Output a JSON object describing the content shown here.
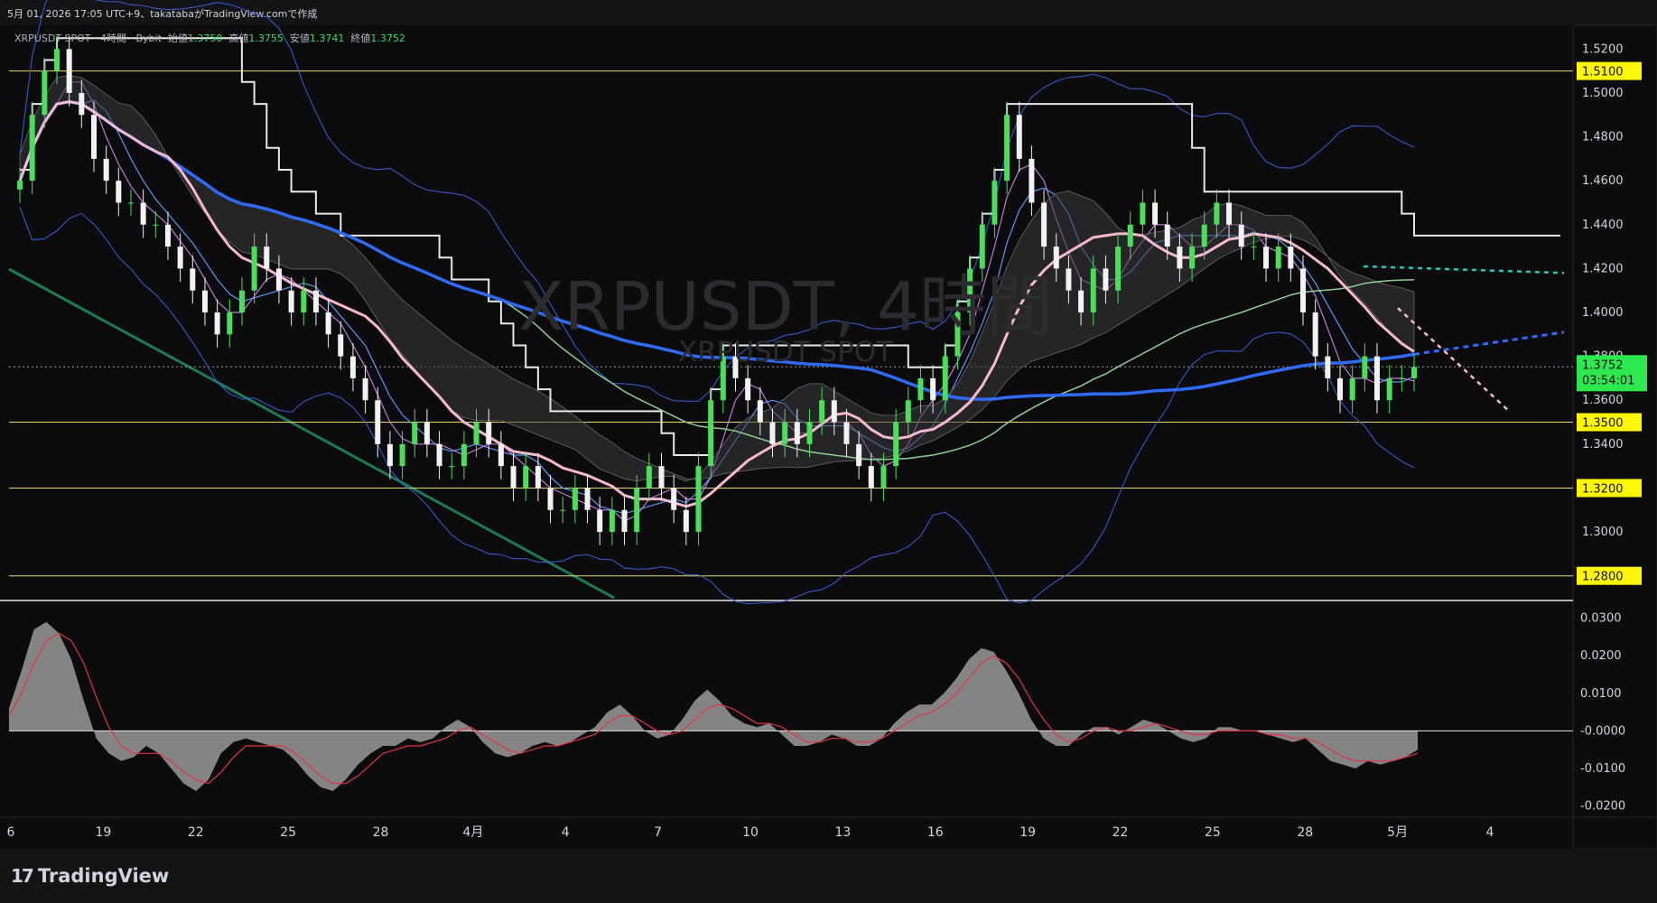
{
  "header": {
    "caption": "5月 01, 2026 17:05 UTC+9、takatabaがTradingView.comで作成"
  },
  "legend": {
    "symbol": "XRPUSDT SPOT · 4時間 · Bybit",
    "open_label": "始値",
    "open": "1.3750",
    "high_label": "高値",
    "high": "1.3755",
    "low_label": "安値",
    "low": "1.3741",
    "close_label": "終値",
    "close": "1.3752"
  },
  "watermark": {
    "title": "XRPUSDT, 4時間",
    "subtitle": "XRPUSDT SPOT"
  },
  "price_tags": {
    "current_price": "1.3752",
    "countdown": "03:54:01"
  },
  "branding": {
    "name": "TradingView",
    "mark": "17"
  },
  "colors": {
    "bg": "#0c0c0e",
    "up": "#4ade5a",
    "down": "#f2f2f2",
    "ma_pink": "#f5b8cc",
    "ma_blue": "#2f6bf5",
    "ma_green": "#8fd08f",
    "bollinger": "#3760d8",
    "trend_green": "#1f7a52",
    "level_yellow": "#e6d96a",
    "white_line": "#e9e9e9",
    "cyan_dash": "#33c4b8",
    "osc_fill": "#9a9a9a",
    "osc_signal": "#e0373f"
  },
  "chart_data": [
    {
      "type": "candlestick",
      "title": "XRPUSDT, 4時間",
      "x_ticks": [
        "6",
        "19",
        "22",
        "25",
        "28",
        "4月",
        "4",
        "7",
        "10",
        "13",
        "16",
        "19",
        "22",
        "25",
        "28",
        "5月",
        "4"
      ],
      "y_ticks": [
        "1.5200",
        "1.5000",
        "1.4800",
        "1.4600",
        "1.4400",
        "1.4200",
        "1.4000",
        "1.3800",
        "1.3600",
        "1.3400",
        "1.3000"
      ],
      "ylim": [
        1.27,
        1.53
      ],
      "horizontal_levels": [
        "1.5100",
        "1.3500",
        "1.3200",
        "1.2800"
      ],
      "last_price": 1.3752,
      "closes": [
        1.46,
        1.49,
        1.51,
        1.52,
        1.5,
        1.49,
        1.47,
        1.46,
        1.45,
        1.45,
        1.44,
        1.44,
        1.43,
        1.42,
        1.41,
        1.4,
        1.39,
        1.4,
        1.41,
        1.43,
        1.42,
        1.41,
        1.4,
        1.41,
        1.4,
        1.39,
        1.38,
        1.37,
        1.36,
        1.34,
        1.33,
        1.34,
        1.35,
        1.34,
        1.33,
        1.33,
        1.34,
        1.35,
        1.34,
        1.33,
        1.32,
        1.33,
        1.32,
        1.31,
        1.31,
        1.32,
        1.31,
        1.3,
        1.31,
        1.3,
        1.32,
        1.33,
        1.32,
        1.31,
        1.3,
        1.33,
        1.36,
        1.38,
        1.37,
        1.36,
        1.35,
        1.34,
        1.35,
        1.34,
        1.35,
        1.36,
        1.35,
        1.34,
        1.33,
        1.32,
        1.33,
        1.35,
        1.36,
        1.37,
        1.36,
        1.38,
        1.4,
        1.42,
        1.44,
        1.46,
        1.49,
        1.47,
        1.45,
        1.43,
        1.42,
        1.41,
        1.4,
        1.42,
        1.41,
        1.43,
        1.44,
        1.45,
        1.44,
        1.43,
        1.42,
        1.43,
        1.44,
        1.45,
        1.44,
        1.43,
        1.43,
        1.42,
        1.43,
        1.42,
        1.4,
        1.38,
        1.37,
        1.36,
        1.37,
        1.38,
        1.36,
        1.37,
        1.37,
        1.3752
      ]
    },
    {
      "type": "area",
      "title": "",
      "y_ticks": [
        "0.0300",
        "0.0200",
        "0.0100",
        "-0.0000",
        "-0.0100",
        "-0.0200"
      ],
      "ylim": [
        -0.0225,
        0.0335
      ],
      "values": [
        0.006,
        0.016,
        0.027,
        0.029,
        0.026,
        0.019,
        0.008,
        -0.002,
        -0.006,
        -0.008,
        -0.007,
        -0.004,
        -0.006,
        -0.01,
        -0.014,
        -0.016,
        -0.013,
        -0.006,
        -0.003,
        -0.002,
        -0.003,
        -0.004,
        -0.005,
        -0.008,
        -0.012,
        -0.015,
        -0.016,
        -0.013,
        -0.009,
        -0.006,
        -0.004,
        -0.004,
        -0.002,
        -0.003,
        -0.002,
        0.001,
        0.003,
        0.001,
        -0.003,
        -0.006,
        -0.007,
        -0.006,
        -0.004,
        -0.003,
        -0.004,
        -0.003,
        -0.001,
        0.001,
        0.005,
        0.007,
        0.004,
        0.0,
        -0.002,
        -0.001,
        0.003,
        0.008,
        0.011,
        0.008,
        0.004,
        0.002,
        0.001,
        0.002,
        -0.001,
        -0.004,
        -0.004,
        -0.003,
        -0.001,
        -0.002,
        -0.004,
        -0.004,
        -0.002,
        0.002,
        0.005,
        0.007,
        0.007,
        0.01,
        0.014,
        0.019,
        0.022,
        0.021,
        0.016,
        0.01,
        0.003,
        -0.002,
        -0.004,
        -0.004,
        -0.001,
        0.001,
        0.001,
        -0.001,
        0.001,
        0.003,
        0.002,
        0.0,
        -0.002,
        -0.003,
        -0.002,
        0.001,
        0.001,
        0.0,
        0.0,
        -0.001,
        -0.002,
        -0.003,
        -0.002,
        -0.005,
        -0.008,
        -0.009,
        -0.01,
        -0.008,
        -0.009,
        -0.008,
        -0.007,
        -0.005
      ],
      "signal": [
        0.004,
        0.01,
        0.018,
        0.024,
        0.026,
        0.024,
        0.018,
        0.009,
        0.001,
        -0.004,
        -0.006,
        -0.006,
        -0.006,
        -0.008,
        -0.011,
        -0.013,
        -0.014,
        -0.011,
        -0.007,
        -0.004,
        -0.004,
        -0.004,
        -0.004,
        -0.006,
        -0.009,
        -0.012,
        -0.014,
        -0.014,
        -0.012,
        -0.009,
        -0.006,
        -0.005,
        -0.004,
        -0.004,
        -0.003,
        -0.002,
        0.0,
        0.001,
        -0.001,
        -0.003,
        -0.005,
        -0.006,
        -0.005,
        -0.004,
        -0.004,
        -0.003,
        -0.002,
        -0.001,
        0.002,
        0.004,
        0.004,
        0.002,
        0.0,
        -0.001,
        0.0,
        0.003,
        0.006,
        0.007,
        0.006,
        0.004,
        0.002,
        0.002,
        0.001,
        -0.001,
        -0.003,
        -0.003,
        -0.002,
        -0.002,
        -0.003,
        -0.003,
        -0.002,
        0.0,
        0.002,
        0.004,
        0.005,
        0.007,
        0.01,
        0.014,
        0.018,
        0.02,
        0.018,
        0.014,
        0.008,
        0.003,
        -0.001,
        -0.003,
        -0.002,
        0.0,
        0.001,
        0.0,
        0.0,
        0.001,
        0.002,
        0.001,
        0.0,
        -0.001,
        -0.001,
        0.0,
        0.0,
        0.0,
        0.0,
        -0.001,
        -0.001,
        -0.002,
        -0.002,
        -0.003,
        -0.005,
        -0.007,
        -0.008,
        -0.008,
        -0.008,
        -0.008,
        -0.007,
        -0.006
      ]
    }
  ]
}
